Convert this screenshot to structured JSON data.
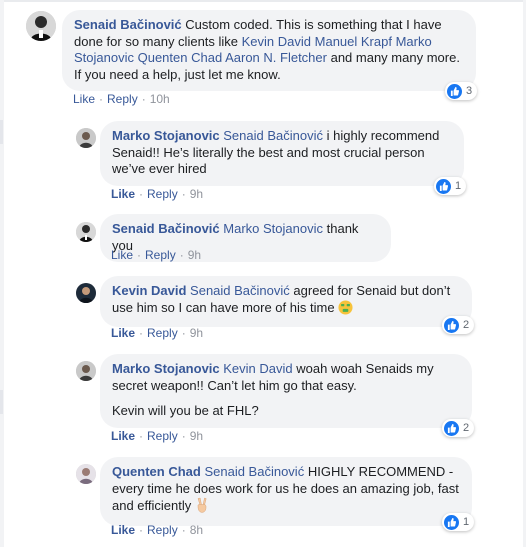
{
  "actions_labels": {
    "like": "Like",
    "reply": "Reply",
    "sep": "·"
  },
  "comments": [
    {
      "author": "Senaid Bačinović",
      "text_pre": "Custom coded. This is something that I have done for so many clients like ",
      "mentions": [
        "Kevin David",
        "Manuel Krapf",
        "Marko Stojanovic",
        "Quenten Chad",
        "Aaron N. Fletcher"
      ],
      "text_post": "and many many more. If you need a help, just let me know.",
      "time": "10h",
      "reactions": "3"
    },
    {
      "author": "Marko Stojanovic",
      "mention": "Senaid Bačinović",
      "text": "i highly recommend Senaid!! He’s literally the best and most crucial person we’ve ever hired",
      "time": "9h",
      "reactions": "1"
    },
    {
      "author": "Senaid Bačinović",
      "mention": "Marko Stojanovic",
      "text": "thank you",
      "time": "9h"
    },
    {
      "author": "Kevin David",
      "mention": "Senaid Bačinović",
      "text": "agreed for Senaid but don’t use him so I can have more of his time",
      "time": "9h",
      "reactions": "2"
    },
    {
      "author": "Marko Stojanovic",
      "mention": "Kevin David",
      "text": "woah woah Senaids my secret weapon!! Can’t let him go that easy.",
      "text2": "Kevin will you be at FHL?",
      "time": "9h",
      "reactions": "2"
    },
    {
      "author": "Quenten Chad",
      "mention": "Senaid Bačinović",
      "text": "HIGHLY RECOMMEND - every time he does work for us he does an amazing job, fast and efficiently",
      "time": "8h",
      "reactions": "1"
    }
  ],
  "colors": {
    "link": "#385898",
    "bubble": "#f2f3f5",
    "like_blue": "#1877f2",
    "meta": "#90949c"
  },
  "emoji": {
    "comment4": "money-mouth-face-icon",
    "comment6": "victory-hand-icon"
  }
}
